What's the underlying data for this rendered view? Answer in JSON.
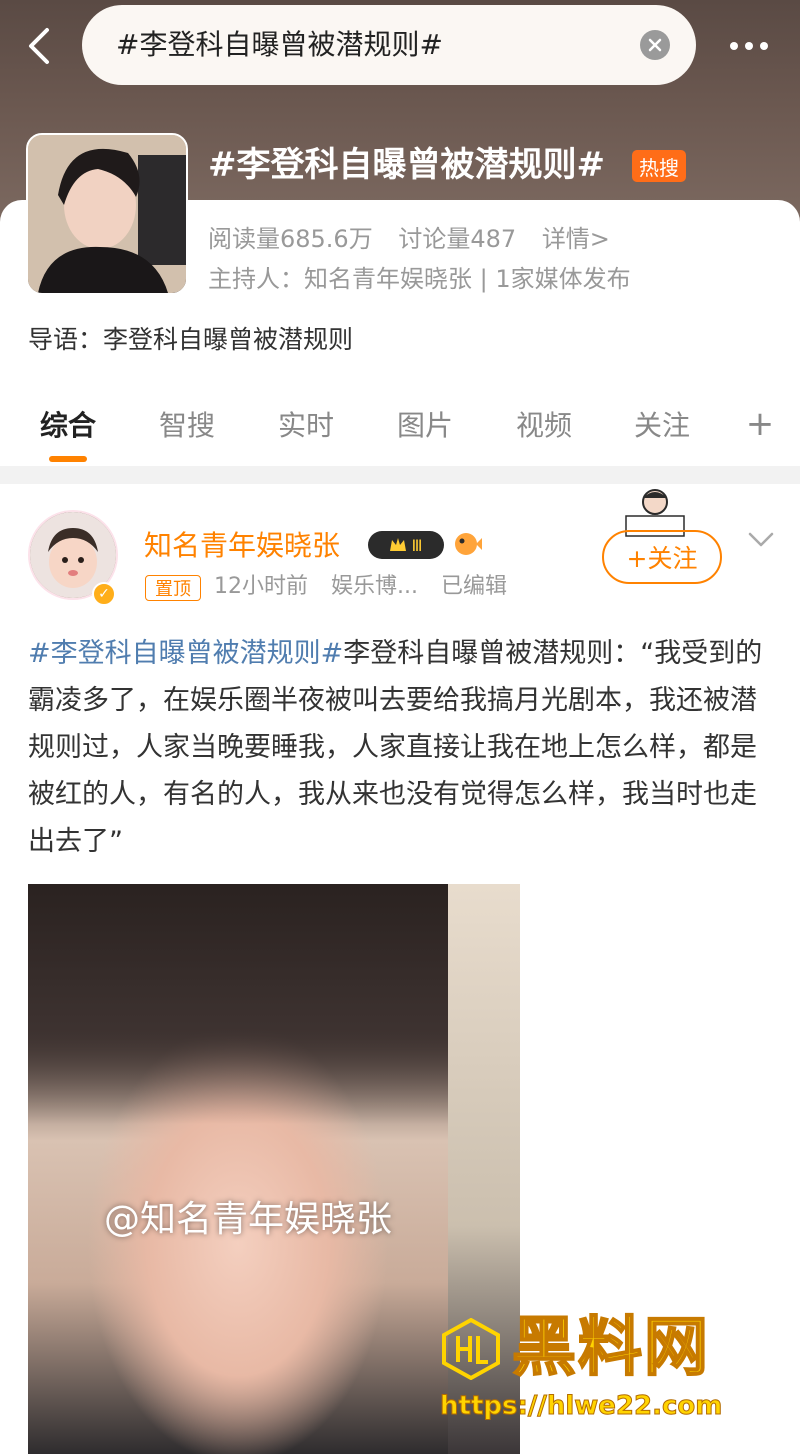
{
  "search": {
    "query": "#李登科自曝曾被潜规则#"
  },
  "topic": {
    "title": "#李登科自曝曾被潜规则#",
    "badge": "热搜",
    "reads": "阅读量685.6万",
    "discussions": "讨论量487",
    "details_link": "详情>",
    "host": "主持人：知名青年娱晓张 | 1家媒体发布",
    "intro": "导语：李登科自曝曾被潜规则"
  },
  "tabs": [
    "综合",
    "智搜",
    "实时",
    "图片",
    "视频",
    "关注"
  ],
  "tab_plus": "+",
  "post": {
    "author": "知名青年娱晓张",
    "vip_level": "Ⅲ",
    "pin_label": "置顶",
    "time": "12小时前",
    "source": "娱乐博...",
    "edited": "已编辑",
    "follow_label": "+关注",
    "hashtag": "#李登科自曝曾被潜规则#",
    "text": "李登科自曝曾被潜规则：“我受到的霸凌多了，在娱乐圈半夜被叫去要给我搞月光剧本，我还被潜规则过，人家当晚要睡我，人家直接让我在地上怎么样，都是被红的人，有名的人，我从来也没有觉得怎么样，我当时也走出去了”",
    "image_watermark": "@知名青年娱晓张"
  },
  "site": {
    "name": "黑料网",
    "url": "https://hlwe22.com"
  },
  "colors": {
    "accent": "#ff8200",
    "hashtag": "#507daf",
    "hot": "#ff6d18"
  }
}
